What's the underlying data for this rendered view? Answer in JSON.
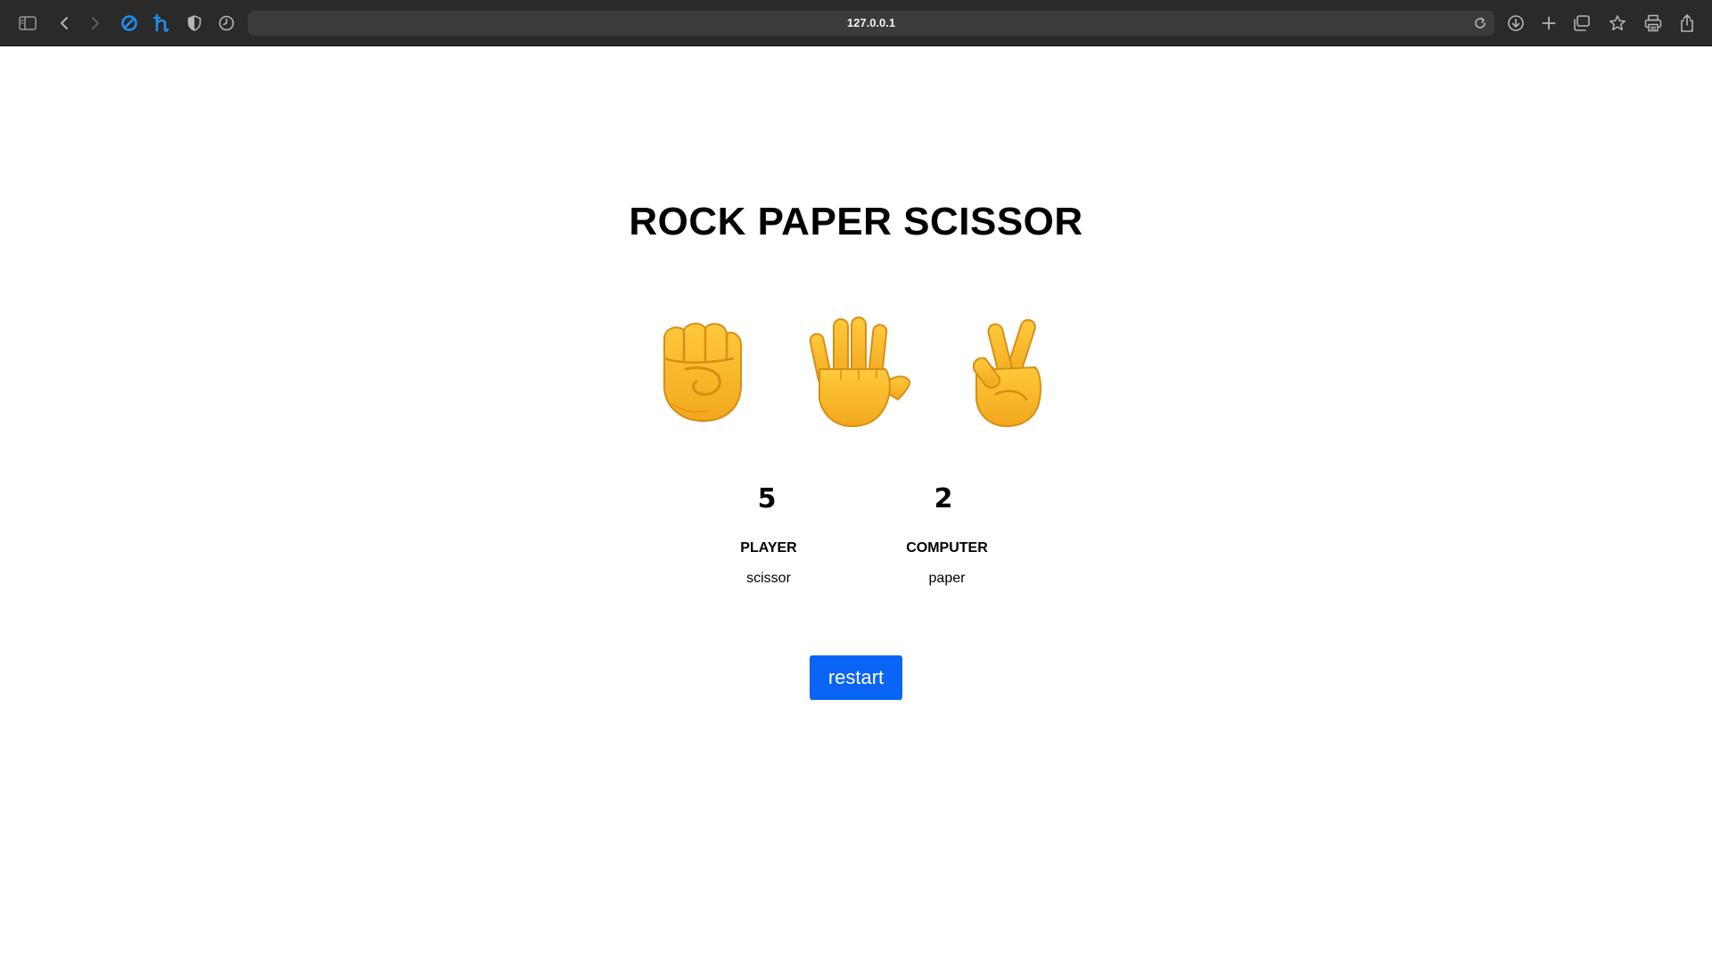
{
  "browser": {
    "url": "127.0.0.1",
    "icons": [
      "sidebar-icon",
      "back-icon",
      "forward-icon",
      "blocker-icon",
      "extension-h-icon",
      "shield-icon",
      "history-icon",
      "reload-icon",
      "download-icon",
      "new-tab-icon",
      "tabs-overview-icon",
      "bookmark-star-icon",
      "print-icon",
      "share-icon"
    ]
  },
  "game": {
    "title": "ROCK PAPER SCISSOR",
    "choices": [
      {
        "name": "rock",
        "icon": "fist-icon"
      },
      {
        "name": "paper",
        "icon": "open-hand-icon"
      },
      {
        "name": "scissor",
        "icon": "crossed-fingers-icon"
      }
    ],
    "player": {
      "score": "5",
      "label": "PLAYER",
      "choice": "scissor"
    },
    "computer": {
      "score": "2",
      "label": "COMPUTER",
      "choice": "paper"
    },
    "restart_label": "restart"
  },
  "colors": {
    "toolbar": "#2a2a2a",
    "url_field": "#3b3b3b",
    "accent_blue": "#0a64f5",
    "hand_fill": "#f7b733",
    "hand_outline": "#d68f16"
  }
}
